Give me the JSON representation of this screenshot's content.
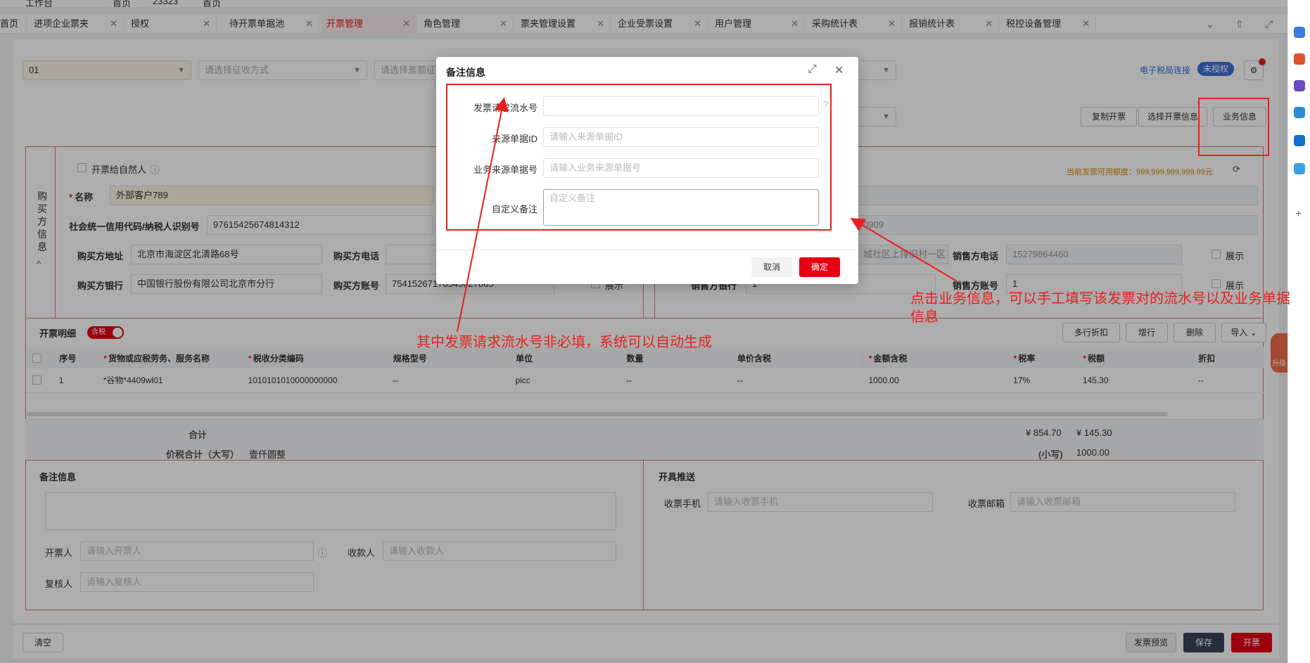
{
  "topbar": {
    "workbench": "工作台",
    "home": "首页",
    "user_num": "23323",
    "home2": "首页"
  },
  "tabs": [
    "首页",
    "进项企业票夹",
    "授权",
    "待开票单据池",
    "开票管理",
    "角色管理",
    "票夹管理设置",
    "企业受票设置",
    "用户管理",
    "采购统计表",
    "报销统计表",
    "税控设备管理"
  ],
  "filters": {
    "org_value": "01",
    "collect_placeholder": "请选择征收方式",
    "diff_placeholder": "请选择差额征",
    "tax_bureau_link": "电子税局连接",
    "auth_badge": "未授权"
  },
  "actions": {
    "copy": "复制开票",
    "select_info": "选择开票信息",
    "business_info": "业务信息"
  },
  "buyer": {
    "section_label": "购买方信息",
    "natural_person": "开票给自然人",
    "name_label": "名称",
    "name_value": "外部客户789",
    "taxid_label": "社会统一信用代码/纳税人识别号",
    "taxid_value": "97615425674814312",
    "address_label": "购买方地址",
    "address_value": "北京市海淀区北清路68号",
    "phone_label": "购买方电话",
    "bank_label": "购买方银行",
    "bank_value": "中国银行股份有限公司北京市分行",
    "account_label": "购买方账号",
    "account_value": "75415267176545627865",
    "show": "展示"
  },
  "seller": {
    "quota": "当前发票可用额度：999,999,999,999.99元",
    "code_partial": "0909",
    "address_partial": "城社区上排旧村一区",
    "phone_label": "销售方电话",
    "phone_value": "15279864460",
    "bank_label": "销售方银行",
    "bank_value": "1",
    "account_label": "销售方账号",
    "account_value": "1",
    "show": "展示"
  },
  "details": {
    "title": "开票明细",
    "tax_toggle": "含税",
    "buttons": [
      "多行折扣",
      "增行",
      "删除",
      "导入"
    ],
    "columns": [
      "序号",
      "货物或应税劳务、服务名称",
      "税收分类编码",
      "规格型号",
      "单位",
      "数量",
      "单价含税",
      "金额含税",
      "税率",
      "税额",
      "折扣"
    ],
    "required_columns": [
      1,
      2,
      7,
      8,
      9
    ],
    "rows": [
      [
        "1",
        "*谷物*4409wl01",
        "1010101010000000000",
        "--",
        "picc",
        "--",
        "--",
        "1000.00",
        "17%",
        "145.30",
        "--"
      ]
    ],
    "total_label": "合计",
    "total_amount": "¥ 854.70",
    "total_tax": "¥ 145.30",
    "price_tax_label": "价税合计（大写）",
    "price_tax_words": "壹仟圆整",
    "small_label": "(小写)",
    "small_value": "1000.00"
  },
  "remarks": {
    "title": "备注信息",
    "drawer_label": "开票人",
    "drawer_ph": "请输入开票人",
    "payee_label": "收款人",
    "payee_ph": "请输入收款人",
    "reviewer_label": "复核人",
    "reviewer_ph": "请输入复核人"
  },
  "push": {
    "title": "开具推送",
    "phone_label": "收票手机",
    "phone_ph": "请输入收票手机",
    "email_label": "收票邮箱",
    "email_ph": "请输入收票邮箱"
  },
  "footer": {
    "clear": "清空",
    "preview": "发票预览",
    "save": "保存",
    "issue": "开票"
  },
  "modal": {
    "title": "备注信息",
    "serial_label": "发票请求流水号",
    "source_id_label": "来源单据ID",
    "source_id_ph": "请输入来源单据ID",
    "biz_no_label": "业务来源单据号",
    "biz_no_ph": "请输入业务来源单据号",
    "remark_label": "自定义备注",
    "remark_ph": "自定义备注",
    "cancel": "取消",
    "confirm": "确定"
  },
  "annotations": {
    "serial_note": "其中发票请求流水号非必填，系统可以自动生成",
    "business_note": "点击业务信息，可以手工填写该发票对的流水号以及业务单据信息"
  },
  "colors": {
    "brand_red": "#e60012",
    "annotation_red": "#e8201f",
    "dark_button": "#3b4358"
  },
  "side_badge": "升级"
}
